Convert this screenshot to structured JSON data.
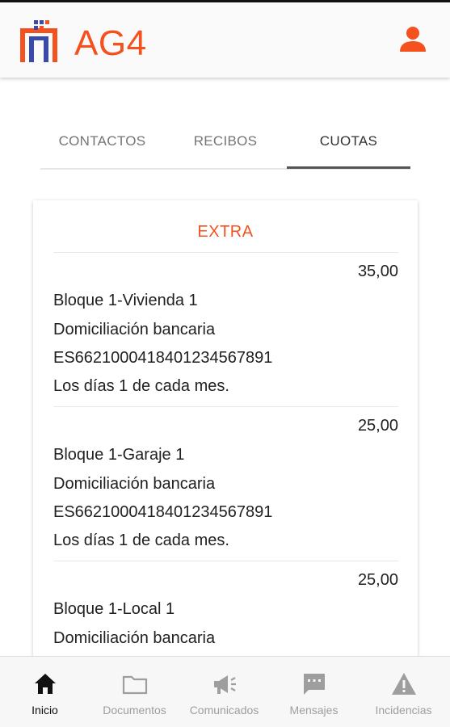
{
  "app": {
    "brand": "AG4",
    "brand_color": "#f4511e",
    "logo_icon": "building-logo-icon",
    "user_icon": "user-icon"
  },
  "tabs": [
    {
      "label": "CONTACTOS",
      "active": false
    },
    {
      "label": "RECIBOS",
      "active": false
    },
    {
      "label": "CUOTAS",
      "active": true
    }
  ],
  "card": {
    "title": "EXTRA",
    "fees": [
      {
        "amount": "35,00",
        "unit": "Bloque 1-Vivienda 1",
        "payment_method": "Domiciliación bancaria",
        "iban": "ES6621000418401234567891",
        "schedule": "Los días 1 de cada mes."
      },
      {
        "amount": "25,00",
        "unit": "Bloque 1-Garaje 1",
        "payment_method": "Domiciliación bancaria",
        "iban": "ES6621000418401234567891",
        "schedule": "Los días 1 de cada mes."
      },
      {
        "amount": "25,00",
        "unit": "Bloque 1-Local 1",
        "payment_method": "Domiciliación bancaria"
      }
    ]
  },
  "bottom_nav": [
    {
      "label": "Inicio",
      "icon": "home-icon",
      "active": true
    },
    {
      "label": "Documentos",
      "icon": "folder-icon",
      "active": false
    },
    {
      "label": "Comunicados",
      "icon": "megaphone-icon",
      "active": false
    },
    {
      "label": "Mensajes",
      "icon": "message-icon",
      "active": false
    },
    {
      "label": "Incidencias",
      "icon": "warning-icon",
      "active": false
    }
  ]
}
